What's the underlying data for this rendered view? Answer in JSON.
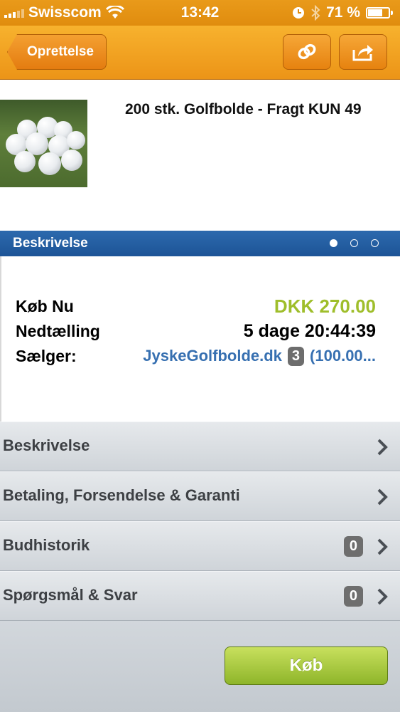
{
  "statusbar": {
    "carrier": "Swisscom",
    "time": "13:42",
    "battery": "71 %",
    "battery_level": 0.71
  },
  "navbar": {
    "back_label": "Oprettelse",
    "icons": [
      "link-icon",
      "share-icon"
    ]
  },
  "product": {
    "title": "200 stk. Golfbolde - Fragt KUN 49",
    "image": "golf-balls-photo"
  },
  "section": {
    "title": "Beskrivelse",
    "page_dots": 3,
    "active_dot": 0
  },
  "info": {
    "buy_now_label": "Køb Nu",
    "price": "DKK 270.00",
    "countdown_label": "Nedtælling",
    "countdown_value": "5 dage 20:44:39",
    "seller_label": "Sælger:",
    "seller_name": "JyskeGolfbolde.dk",
    "seller_rating": "3",
    "seller_feedback": "(100.00..."
  },
  "menu": [
    {
      "label": "Beskrivelse"
    },
    {
      "label": "Betaling, Forsendelse & Garanti"
    },
    {
      "label": "Budhistorik",
      "count": "0"
    },
    {
      "label": "Spørgsmål & Svar",
      "count": "0"
    }
  ],
  "buy_button": "Køb",
  "colors": {
    "nav_orange": "#ec9417",
    "section_blue": "#1d5497",
    "price_green": "#9fbe2b",
    "link_blue": "#3770b1",
    "buy_green": "#8eb52a"
  }
}
